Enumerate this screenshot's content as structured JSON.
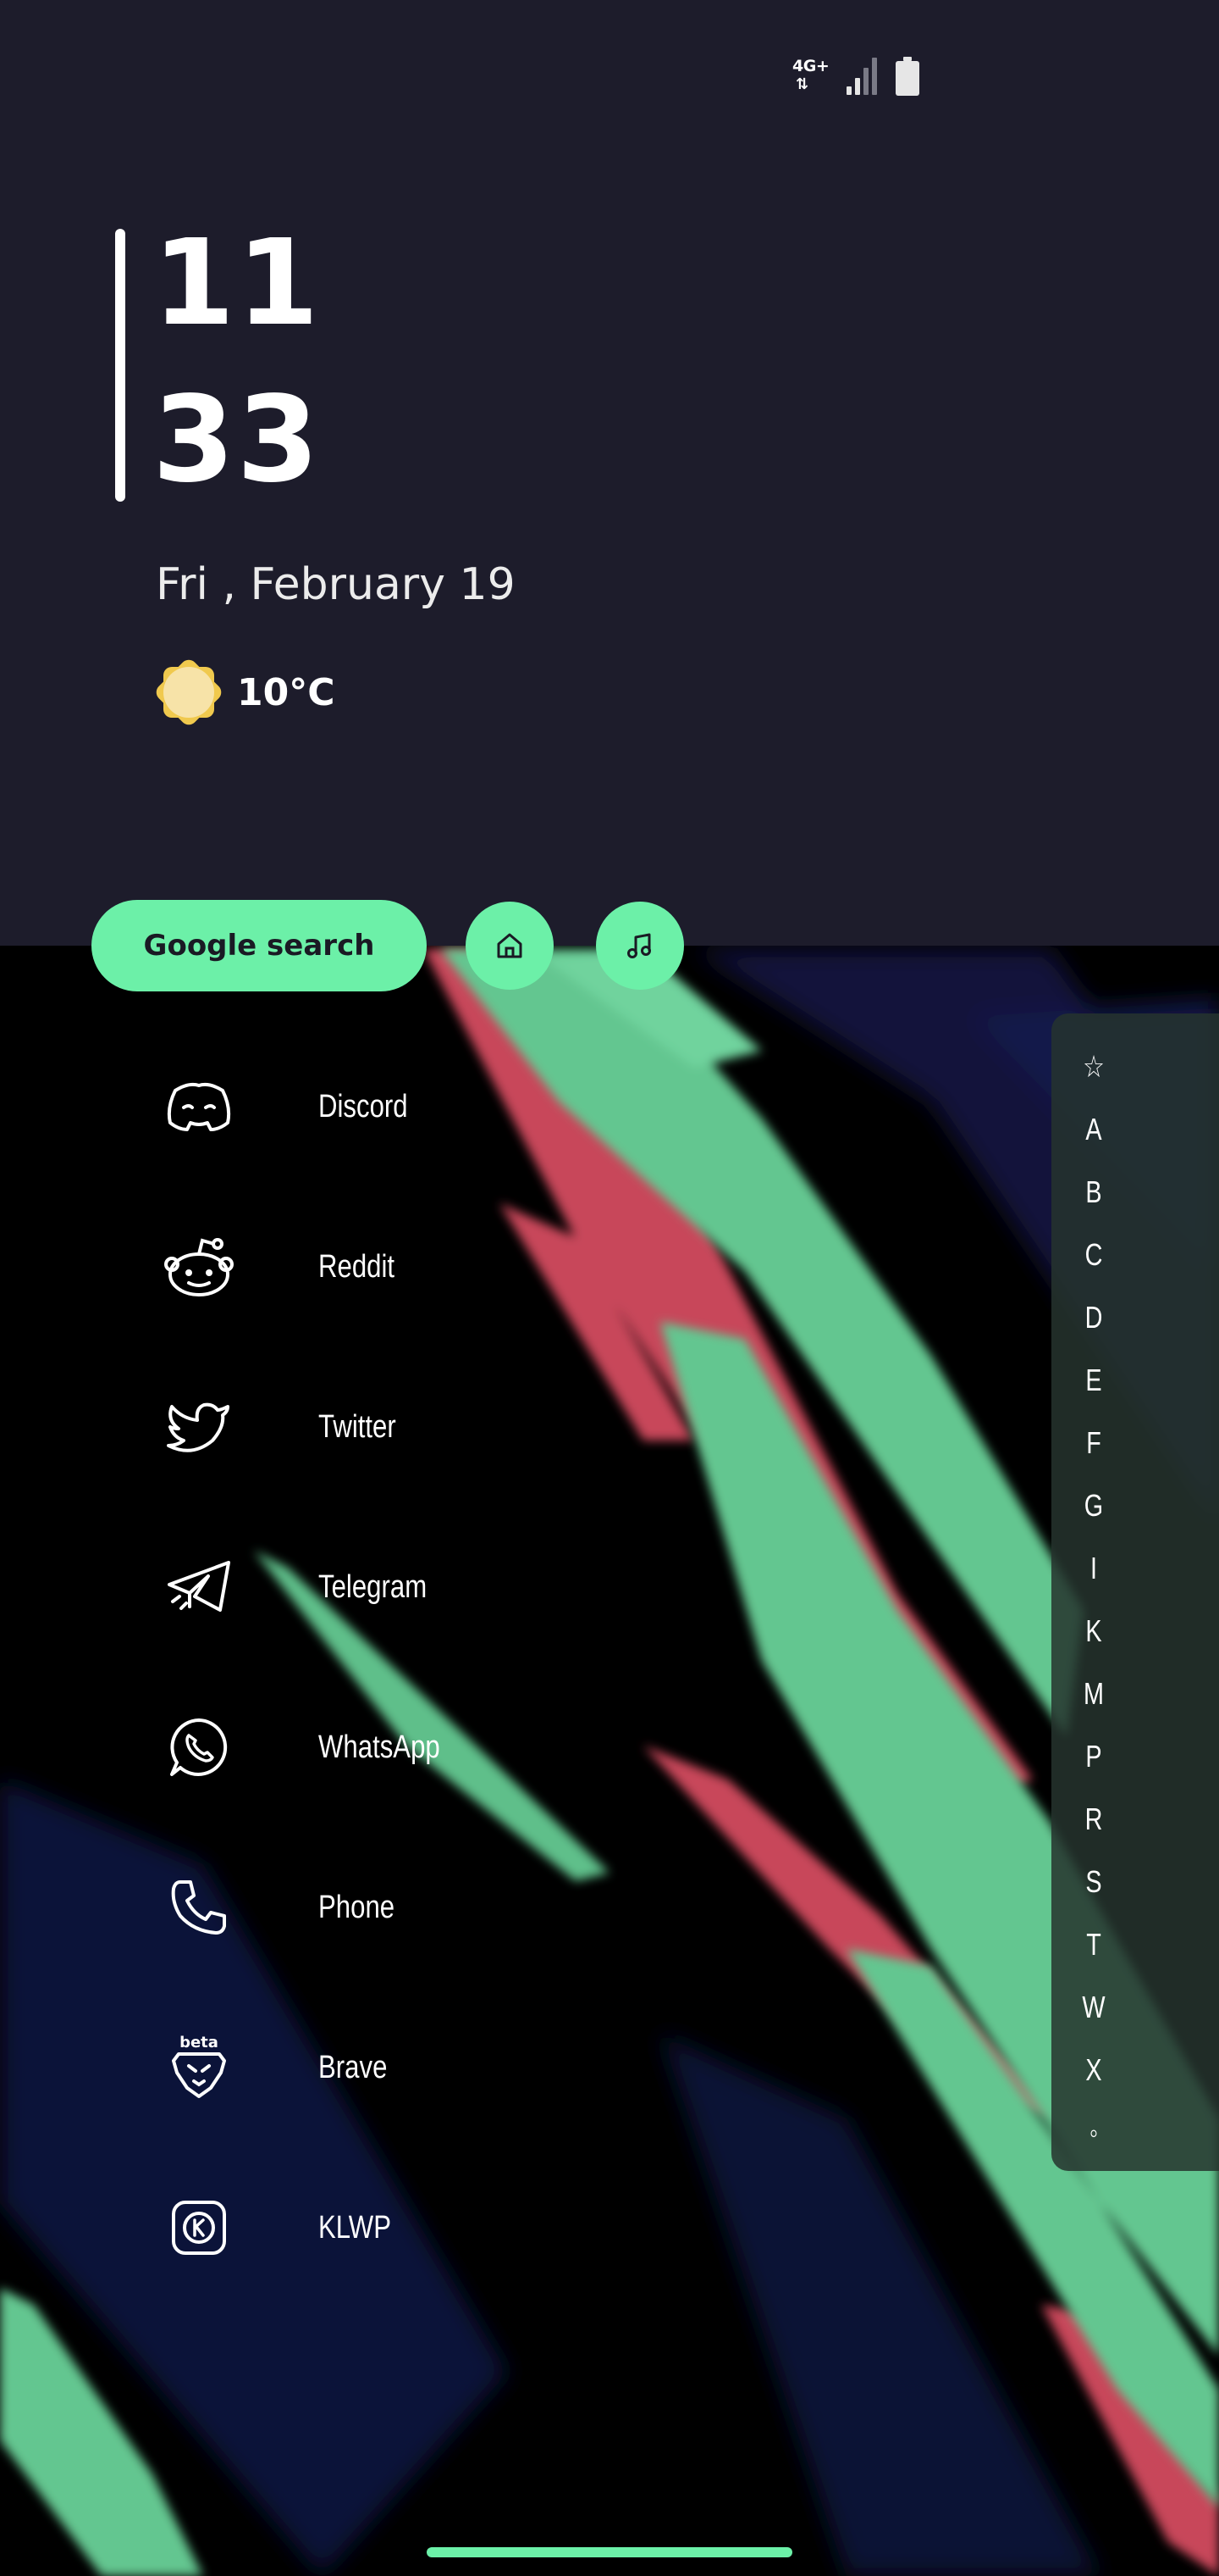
{
  "status_bar": {
    "network_label": "4G+",
    "network_icon": "data-arrows-icon",
    "signal_icon": "signal-icon",
    "battery_icon": "battery-icon"
  },
  "clock": {
    "hour": "11",
    "minute": "33"
  },
  "date": "Fri , February 19",
  "weather": {
    "icon": "sun-icon",
    "temperature": "10°C"
  },
  "search": {
    "label": "Google search"
  },
  "quick_buttons": [
    {
      "name": "home",
      "icon": "home-icon"
    },
    {
      "name": "music",
      "icon": "music-note-icon"
    }
  ],
  "apps": [
    {
      "label": "Discord",
      "icon": "discord-icon"
    },
    {
      "label": "Reddit",
      "icon": "reddit-icon"
    },
    {
      "label": "Twitter",
      "icon": "twitter-icon"
    },
    {
      "label": "Telegram",
      "icon": "telegram-icon"
    },
    {
      "label": "WhatsApp",
      "icon": "whatsapp-icon"
    },
    {
      "label": "Phone",
      "icon": "phone-icon"
    },
    {
      "label": "Brave",
      "icon": "brave-icon",
      "badge": "beta"
    },
    {
      "label": "KLWP",
      "icon": "klwp-icon"
    }
  ],
  "alphabet_index": [
    "☆",
    "A",
    "B",
    "C",
    "D",
    "E",
    "F",
    "G",
    "I",
    "K",
    "M",
    "P",
    "R",
    "S",
    "T",
    "W",
    "X",
    "◦"
  ],
  "colors": {
    "panel": "#1d1c2b",
    "accent": "#6cf0a8",
    "wallpaper_green": "#63c690",
    "wallpaper_red": "#c8465a",
    "wallpaper_navy": "#141a45"
  }
}
